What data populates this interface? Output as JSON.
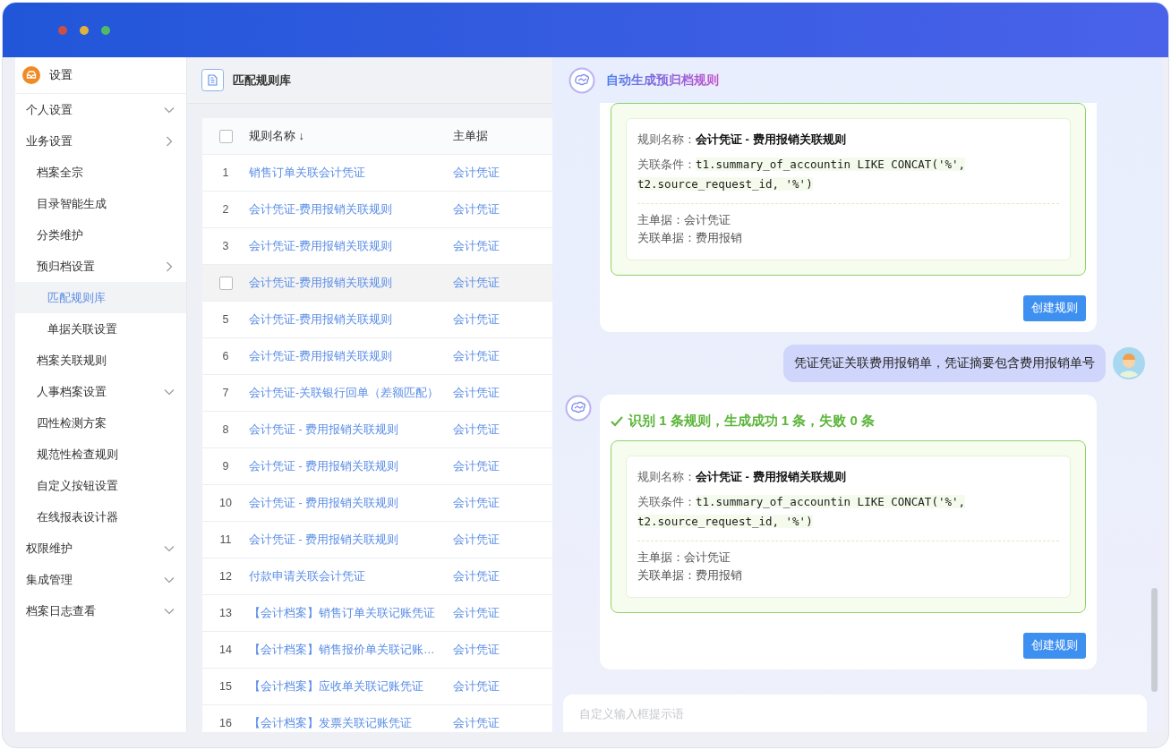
{
  "sidebar": {
    "title": "设置",
    "items": [
      {
        "label": "个人设置",
        "expanded": true,
        "selected": false
      },
      {
        "label": "业务设置",
        "expanded": false,
        "selected": false,
        "children": [
          {
            "label": "档案全宗",
            "selected": false
          },
          {
            "label": "目录智能生成",
            "selected": false
          },
          {
            "label": "分类维护",
            "selected": false
          },
          {
            "label": "预归档设置",
            "expanded": false,
            "selected": false,
            "children": [
              {
                "label": "匹配规则库",
                "selected": true
              },
              {
                "label": "单据关联设置",
                "selected": false
              }
            ]
          },
          {
            "label": "档案关联规则",
            "selected": false
          },
          {
            "label": "人事档案设置",
            "expanded": true,
            "selected": false
          },
          {
            "label": "四性检测方案",
            "selected": false
          },
          {
            "label": "规范性检查规则",
            "selected": false
          },
          {
            "label": "自定义按钮设置",
            "selected": false
          },
          {
            "label": "在线报表设计器",
            "selected": false
          }
        ]
      },
      {
        "label": "权限维护",
        "expanded": true,
        "selected": false
      },
      {
        "label": "集成管理",
        "expanded": true,
        "selected": false
      },
      {
        "label": "档案日志查看",
        "expanded": true,
        "selected": false
      }
    ]
  },
  "page": {
    "title": "匹配规则库"
  },
  "table": {
    "header_checked": false,
    "columns": [
      "规则名称 ↓",
      "主单据"
    ],
    "rows": [
      {
        "number": "1",
        "name": "销售订单关联会计凭证",
        "main": "会计凭证",
        "hovered": false
      },
      {
        "number": "2",
        "name": "会计凭证-费用报销关联规则",
        "main": "会计凭证",
        "hovered": false
      },
      {
        "number": "3",
        "name": "会计凭证-费用报销关联规则",
        "main": "会计凭证",
        "hovered": false
      },
      {
        "name": "会计凭证-费用报销关联规则",
        "main": "会计凭证",
        "hovered": true,
        "checked": false
      },
      {
        "number": "5",
        "name": "会计凭证-费用报销关联规则",
        "main": "会计凭证",
        "hovered": false
      },
      {
        "number": "6",
        "name": "会计凭证-费用报销关联规则",
        "main": "会计凭证",
        "hovered": false
      },
      {
        "number": "7",
        "name": "会计凭证-关联银行回单（差额匹配）",
        "main": "会计凭证",
        "hovered": false
      },
      {
        "number": "8",
        "name": "会计凭证 - 费用报销关联规则",
        "main": "会计凭证",
        "hovered": false
      },
      {
        "number": "9",
        "name": "会计凭证 - 费用报销关联规则",
        "main": "会计凭证",
        "hovered": false
      },
      {
        "number": "10",
        "name": "会计凭证 - 费用报销关联规则",
        "main": "会计凭证",
        "hovered": false
      },
      {
        "number": "11",
        "name": "会计凭证 - 费用报销关联规则",
        "main": "会计凭证",
        "hovered": false
      },
      {
        "number": "12",
        "name": "付款申请关联会计凭证",
        "main": "会计凭证",
        "hovered": false
      },
      {
        "number": "13",
        "name": "【会计档案】销售订单关联记账凭证",
        "main": "会计凭证",
        "hovered": false
      },
      {
        "number": "14",
        "name": "【会计档案】销售报价单关联记账…",
        "main": "会计凭证",
        "hovered": false
      },
      {
        "number": "15",
        "name": "【会计档案】应收单关联记账凭证",
        "main": "会计凭证",
        "hovered": false
      },
      {
        "number": "16",
        "name": "【会计档案】发票关联记账凭证",
        "main": "会计凭证",
        "hovered": false
      }
    ]
  },
  "chat": {
    "title": "自动生成预归档规则",
    "messages": [
      {
        "kind": "bot",
        "avatar": false,
        "rule": {
          "name_label": "规则名称：",
          "name": "会计凭证 - 费用报销关联规则",
          "condition_label": "关联条件：",
          "condition": "t1.summary_of_accountin LIKE CONCAT('%', t2.source_request_id, '%')",
          "main_label": "主单据：",
          "main": "会计凭证",
          "related_label": "关联单据：",
          "related": "费用报销"
        },
        "button": "创建规则"
      },
      {
        "kind": "user",
        "text": "凭证凭证关联费用报销单，凭证摘要包含费用报销单号"
      },
      {
        "kind": "bot",
        "avatar": true,
        "status": "识别 1 条规则，生成成功 1 条，失败 0 条",
        "rule": {
          "name_label": "规则名称：",
          "name": "会计凭证 - 费用报销关联规则",
          "condition_label": "关联条件：",
          "condition": "t1.summary_of_accountin LIKE CONCAT('%', t2.source_request_id, '%')",
          "main_label": "主单据：",
          "main": "会计凭证",
          "related_label": "关联单据：",
          "related": "费用报销"
        },
        "button": "创建规则"
      }
    ],
    "input": {
      "placeholder": "自定义输入框提示语"
    }
  }
}
